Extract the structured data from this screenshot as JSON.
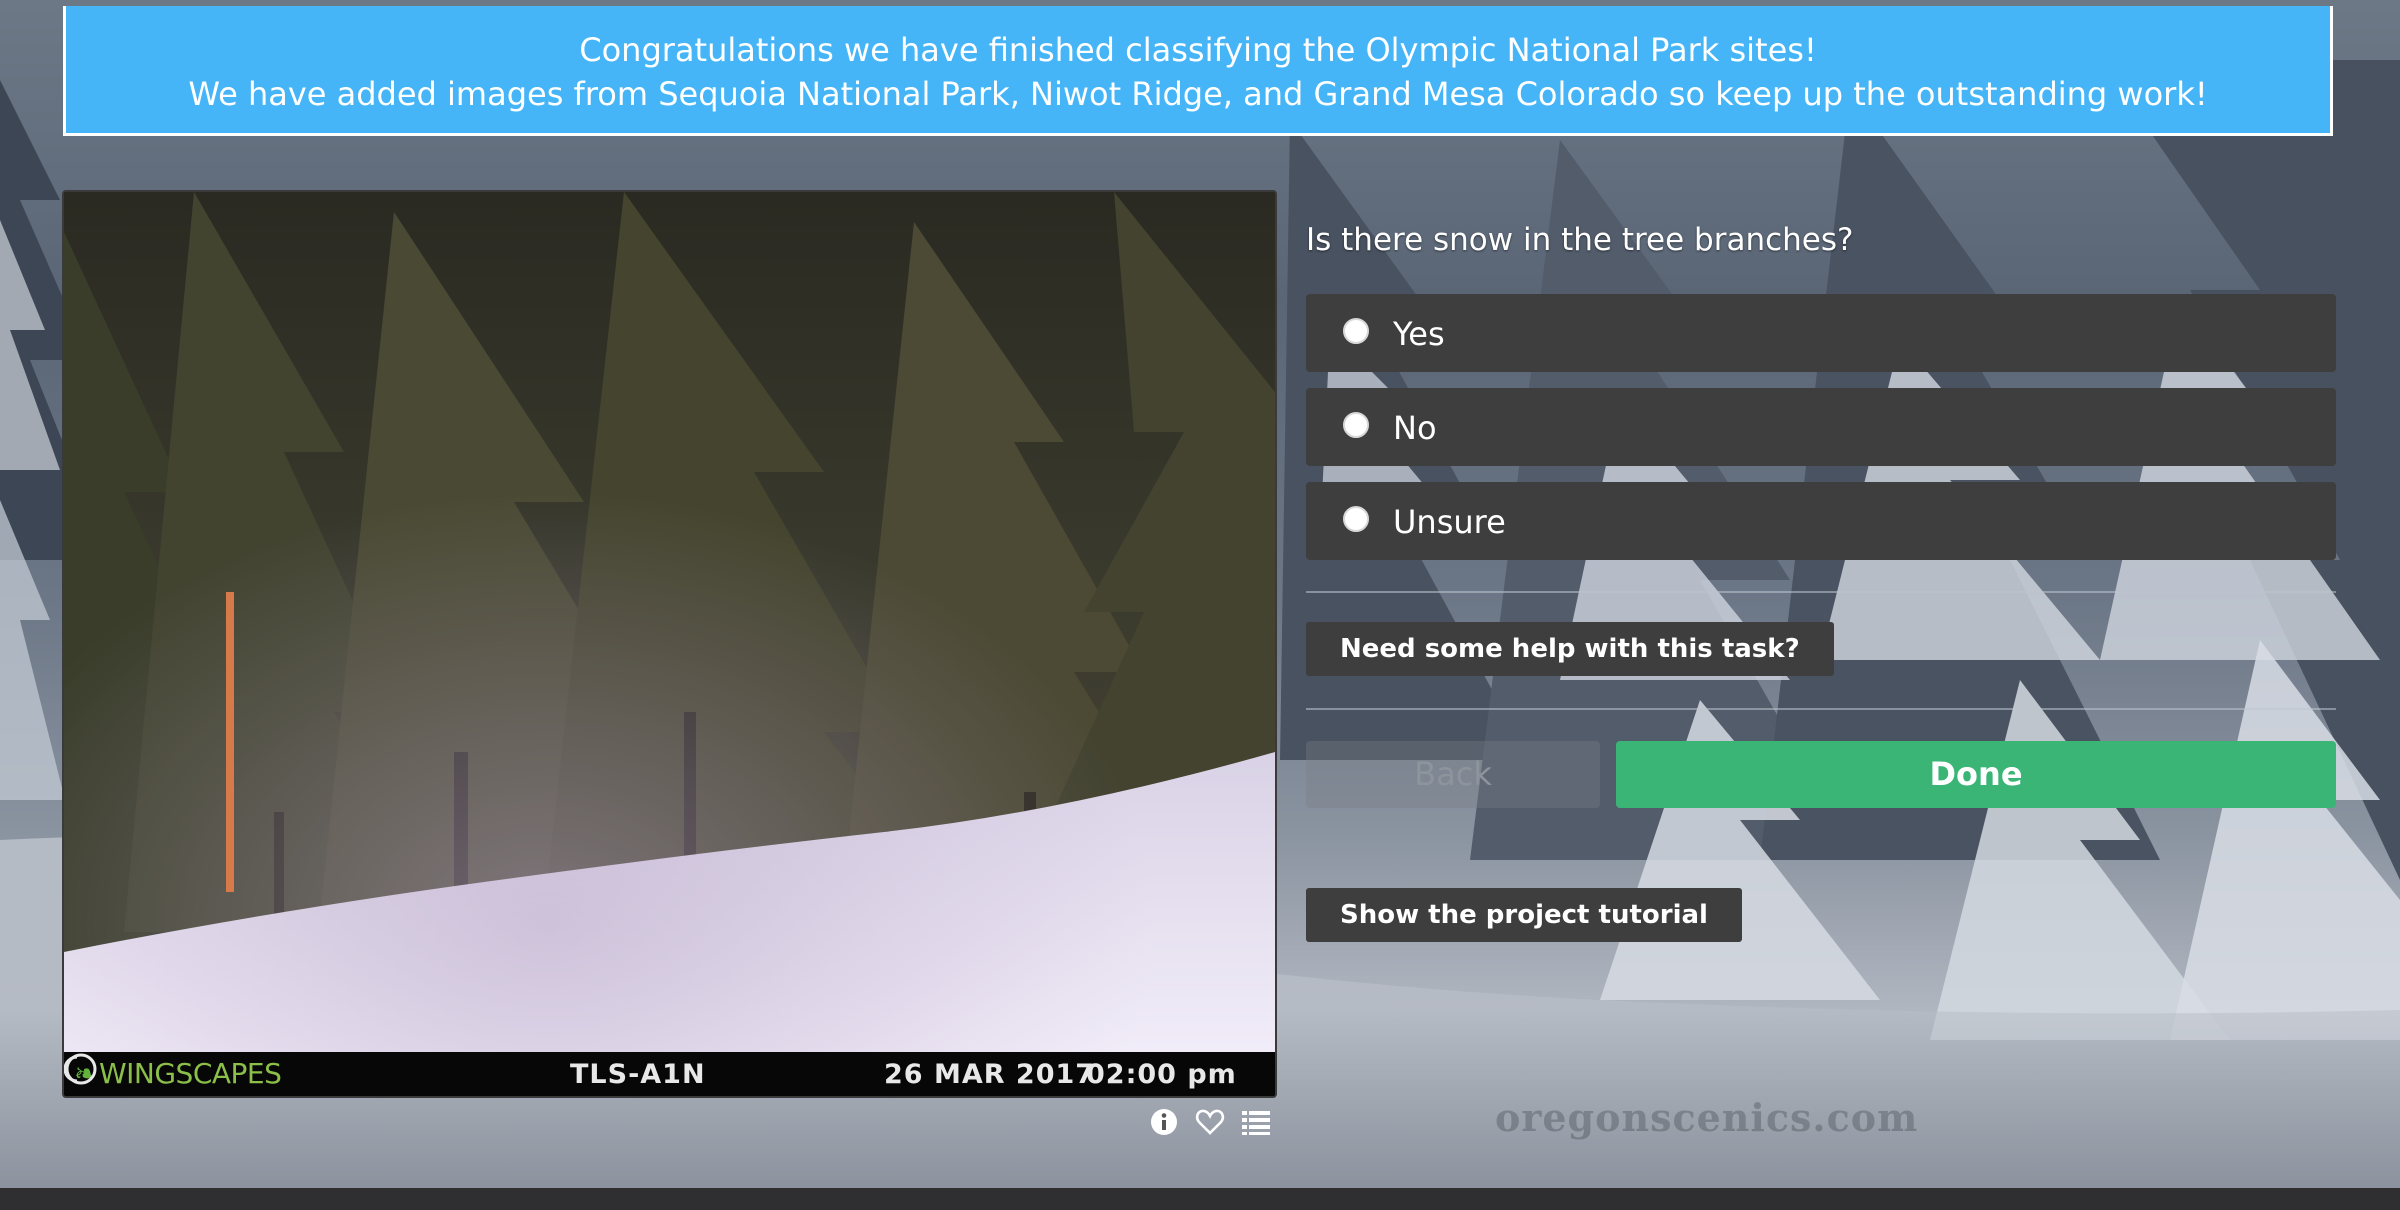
{
  "banner": {
    "line1": "Congratulations we have finished classifying the Olympic National Park sites!",
    "line2": "We have added images from Sequoia National Park, Niwot Ridge, and Grand Mesa Colorado so keep up the outstanding work!"
  },
  "subject": {
    "camera_brand": "WINGSCAPES",
    "camera_id": "TLS-A1N",
    "date": "26 MAR 2017",
    "time": "02:00 pm",
    "meta_icons": [
      "info-icon",
      "heart-icon",
      "collections-list-icon"
    ]
  },
  "task": {
    "question": "Is there snow in the tree branches?",
    "answers": [
      {
        "label": "Yes",
        "selected": false
      },
      {
        "label": "No",
        "selected": false
      },
      {
        "label": "Unsure",
        "selected": false
      }
    ],
    "help_label": "Need some help with this task?",
    "back_label": "Back",
    "done_label": "Done",
    "tutorial_label": "Show the project tutorial"
  },
  "background": {
    "watermark": "oregonscenics.com"
  },
  "colors": {
    "banner": "#45b5f8",
    "done": "#3ab575",
    "answer_bg": "#3e3e3e"
  }
}
